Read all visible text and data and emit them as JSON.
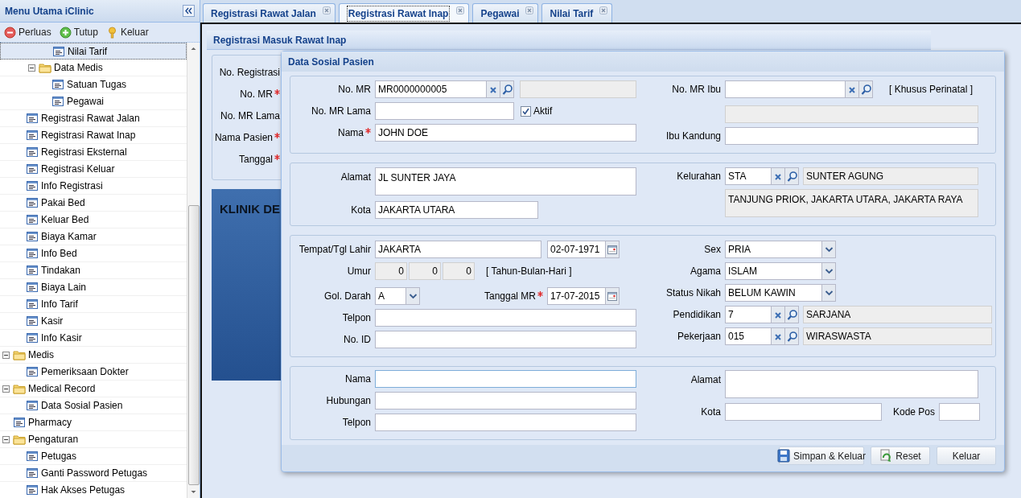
{
  "sidebar": {
    "title": "Menu Utama iClinic",
    "toolbar": [
      {
        "label": "Perluas",
        "kind": "collapse"
      },
      {
        "label": "Tutup",
        "kind": "expand"
      },
      {
        "label": "Keluar",
        "kind": "exit"
      }
    ],
    "tree": [
      {
        "children": [
          {
            "children": [
              {
                "children": [
                  {
                    "label": "Nilai Tarif",
                    "selected": true
                  }
                ]
              },
              {
                "label": "Data Medis",
                "selected": false,
                "expanded": true,
                "children": [
                  {
                    "label": "Satuan Tugas",
                    "selected": false
                  },
                  {
                    "label": "Pegawai",
                    "selected": false
                  }
                ]
              }
            ]
          },
          {
            "label": "Registrasi Rawat Jalan",
            "selected": false
          },
          {
            "label": "Registrasi Rawat Inap",
            "selected": false
          },
          {
            "label": "Registrasi Eksternal",
            "selected": false
          },
          {
            "label": "Registrasi Keluar",
            "selected": false
          },
          {
            "label": "Info Registrasi",
            "selected": false
          },
          {
            "label": "Pakai Bed",
            "selected": false
          },
          {
            "label": "Keluar Bed",
            "selected": false
          },
          {
            "label": "Biaya Kamar",
            "selected": false
          },
          {
            "label": "Info Bed",
            "selected": false
          },
          {
            "label": "Tindakan",
            "selected": false
          },
          {
            "label": "Biaya Lain",
            "selected": false
          },
          {
            "label": "Info Tarif",
            "selected": false
          },
          {
            "label": "Kasir",
            "selected": false
          },
          {
            "label": "Info Kasir",
            "selected": false
          }
        ]
      },
      {
        "label": "Medis",
        "selected": false,
        "expanded": true,
        "children": [
          {
            "label": "Pemeriksaan Dokter",
            "selected": false
          }
        ]
      },
      {
        "label": "Medical Record",
        "selected": false,
        "expanded": true,
        "children": [
          {
            "label": "Data Sosial Pasien",
            "selected": false
          }
        ]
      },
      {
        "label": "Pharmacy",
        "selected": false
      },
      {
        "label": "Pengaturan",
        "selected": false,
        "expanded": true,
        "children": [
          {
            "label": "Petugas",
            "selected": false
          },
          {
            "label": "Ganti Password Petugas",
            "selected": false
          },
          {
            "label": "Hak Akses Petugas",
            "selected": false
          }
        ]
      }
    ]
  },
  "tabs": [
    {
      "label": "Registrasi Rawat Jalan",
      "selected": false
    },
    {
      "label": "Registrasi Rawat Inap",
      "selected": true
    },
    {
      "label": "Pegawai",
      "selected": false
    },
    {
      "label": "Nilai Tarif",
      "selected": false
    }
  ],
  "panel": {
    "title": "Registrasi Masuk Rawat Inap",
    "labels": [
      {
        "text": "No. Registrasi",
        "required": false
      },
      {
        "text": "No. MR",
        "required": true
      },
      {
        "text": "No. MR Lama",
        "required": false
      },
      {
        "text": "Nama Pasien",
        "required": true
      },
      {
        "text": "Tanggal",
        "required": true
      }
    ],
    "banner": "KLINIK DE"
  },
  "dialog": {
    "title": "Data Sosial Pasien",
    "identity": {
      "no_mr": {
        "label": "No. MR",
        "required": false,
        "value": "MR0000000005"
      },
      "no_mr_lama": {
        "label": "No. MR Lama",
        "required": false
      },
      "aktif": {
        "label": "Aktif",
        "checked": true
      },
      "nama": {
        "label": "Nama",
        "required": true,
        "value": "JOHN DOE"
      },
      "no_mr_ibu": {
        "label": "No. MR Ibu",
        "required": false
      },
      "note": "[ Khusus Perinatal ]",
      "ibu_kandung": {
        "label": "Ibu Kandung",
        "required": false
      }
    },
    "address": {
      "alamat": {
        "label": "Alamat",
        "required": false,
        "value": "JL SUNTER JAYA"
      },
      "kota": {
        "label": "Kota",
        "required": false,
        "value": "JAKARTA UTARA"
      },
      "kelurahan": {
        "label": "Kelurahan",
        "required": false,
        "code": "STA",
        "name": "SUNTER AGUNG",
        "region": "TANJUNG PRIOK, JAKARTA UTARA, JAKARTA RAYA"
      }
    },
    "personal": {
      "tempat_lahir": {
        "label": "Tempat/Tgl Lahir",
        "required": false,
        "value": "JAKARTA",
        "date": "02-07-1971"
      },
      "umur": {
        "label": "Umur",
        "required": false,
        "values": [
          "0",
          "0",
          "0"
        ],
        "note": "[ Tahun-Bulan-Hari ]"
      },
      "gol_darah": {
        "label": "Gol. Darah",
        "required": false,
        "value": "A"
      },
      "tanggal_mr": {
        "label": "Tanggal MR",
        "required": true,
        "value": "17-07-2015"
      },
      "telpon": {
        "label": "Telpon",
        "required": false
      },
      "no_id": {
        "label": "No. ID",
        "required": false
      },
      "sex": {
        "label": "Sex",
        "required": false,
        "value": "PRIA"
      },
      "agama": {
        "label": "Agama",
        "required": false,
        "value": "ISLAM"
      },
      "status_nikah": {
        "label": "Status Nikah",
        "required": false,
        "value": "BELUM KAWIN"
      },
      "pendidikan": {
        "label": "Pendidikan",
        "required": false,
        "code": "7",
        "name": "SARJANA"
      },
      "pekerjaan": {
        "label": "Pekerjaan",
        "required": false,
        "code": "015",
        "name": "WIRASWASTA"
      }
    },
    "contact": {
      "nama": {
        "label": "Nama",
        "required": false,
        "focused": true
      },
      "hubungan": {
        "label": "Hubungan",
        "required": false,
        "focused": false
      },
      "telpon": {
        "label": "Telpon",
        "required": false,
        "focused": false
      },
      "alamat": {
        "label": "Alamat",
        "required": false,
        "focused": false
      },
      "kota": {
        "label": "Kota",
        "required": false,
        "focused": false
      },
      "kode_pos": {
        "label": "Kode Pos",
        "required": false,
        "focused": false
      }
    },
    "buttons": [
      {
        "label": "Simpan & Keluar",
        "kind": "save"
      },
      {
        "label": "Reset",
        "kind": "reset"
      },
      {
        "label": "Keluar",
        "kind": "plain"
      }
    ]
  }
}
